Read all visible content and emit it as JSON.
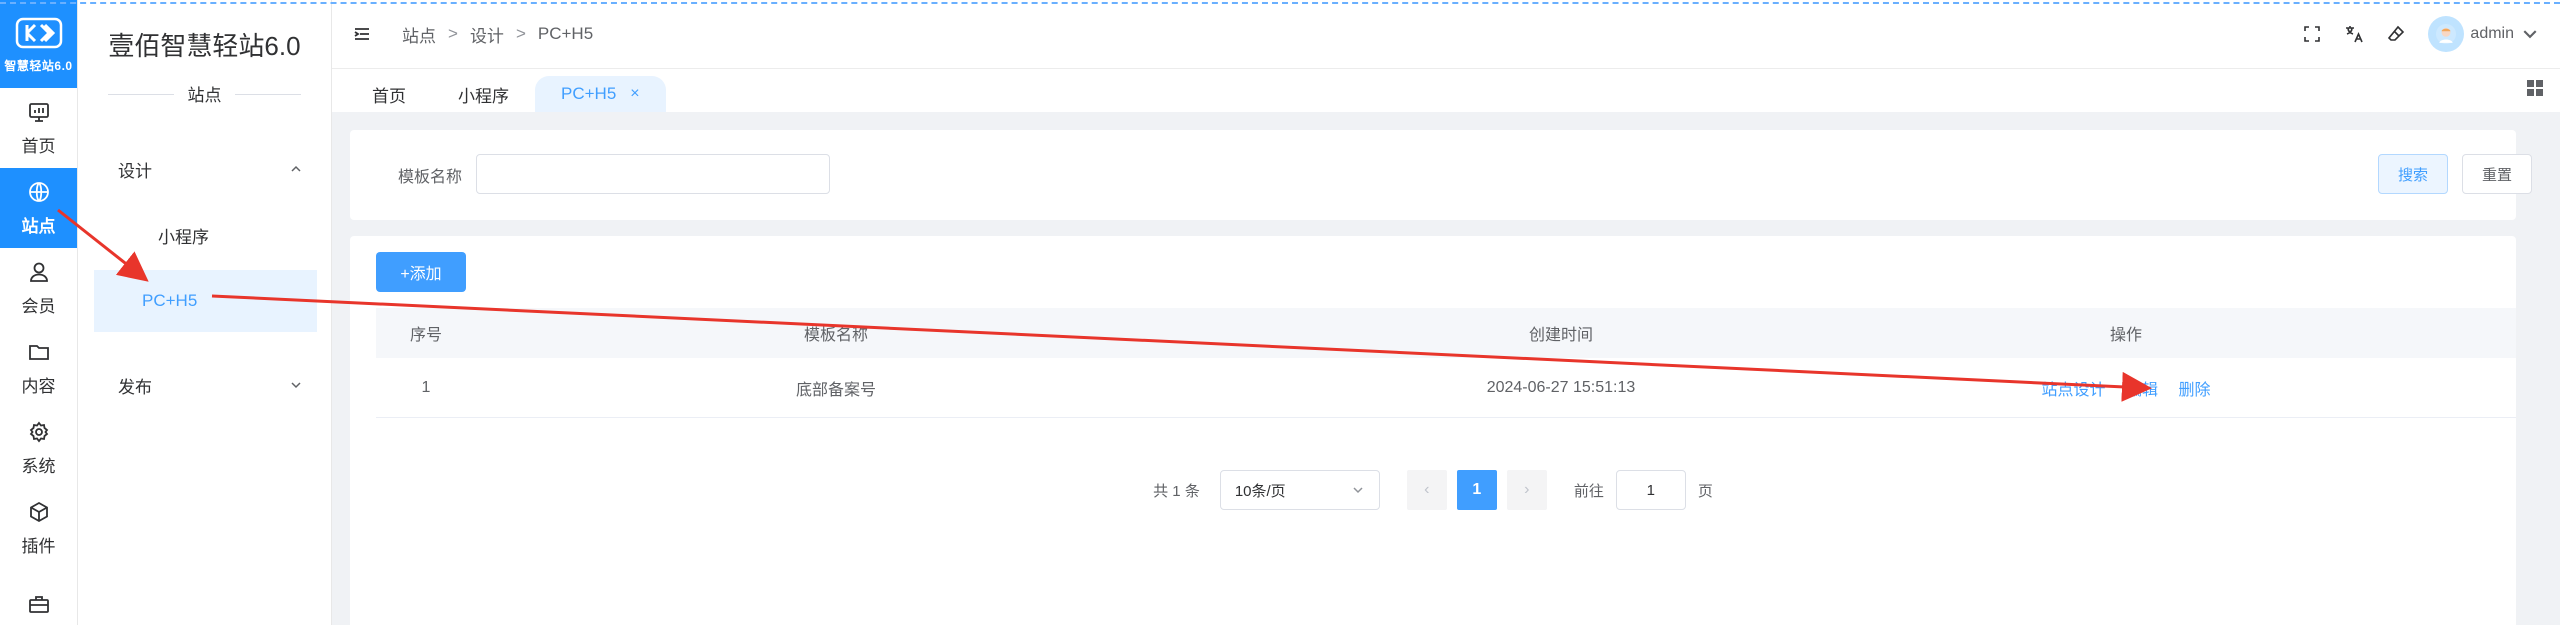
{
  "logo": {
    "text": "智慧轻站6.0"
  },
  "rail": {
    "items": [
      {
        "label": "首页",
        "icon": "monitor-icon"
      },
      {
        "label": "站点",
        "icon": "globe-icon",
        "active": true
      },
      {
        "label": "会员",
        "icon": "user-icon"
      },
      {
        "label": "内容",
        "icon": "folder-icon"
      },
      {
        "label": "系统",
        "icon": "gear-icon"
      },
      {
        "label": "插件",
        "icon": "cube-icon"
      }
    ]
  },
  "sidebar": {
    "title": "壹佰智慧轻站6.0",
    "subtitle": "站点",
    "groups": [
      {
        "label": "设计",
        "expanded": true,
        "items": [
          {
            "label": "小程序"
          },
          {
            "label": "PC+H5",
            "active": true
          }
        ]
      },
      {
        "label": "发布",
        "expanded": false
      }
    ]
  },
  "header": {
    "breadcrumb": [
      "站点",
      "设计",
      "PC+H5"
    ],
    "separator": ">",
    "user": "admin"
  },
  "tabs": [
    {
      "label": "首页"
    },
    {
      "label": "小程序"
    },
    {
      "label": "PC+H5",
      "active": true,
      "close": "×"
    }
  ],
  "search": {
    "label": "模板名称",
    "value": "",
    "search_button": "搜索",
    "reset_button": "重置"
  },
  "table": {
    "add_button": "+添加",
    "columns": [
      "序号",
      "模板名称",
      "创建时间",
      "操作"
    ],
    "rows": [
      {
        "index": "1",
        "name": "底部备案号",
        "created": "2024-06-27 15:51:13",
        "actions": [
          "站点设计",
          "编辑",
          "删除"
        ]
      }
    ]
  },
  "pagination": {
    "total": "共 1 条",
    "page_size": "10条/页",
    "prev": "‹",
    "next": "›",
    "current": "1",
    "goto_label": "前往",
    "goto_value": "1",
    "goto_unit": "页"
  },
  "colors": {
    "accent": "#409eff",
    "brand": "#1e90ff",
    "annotation": "#e8352b"
  }
}
